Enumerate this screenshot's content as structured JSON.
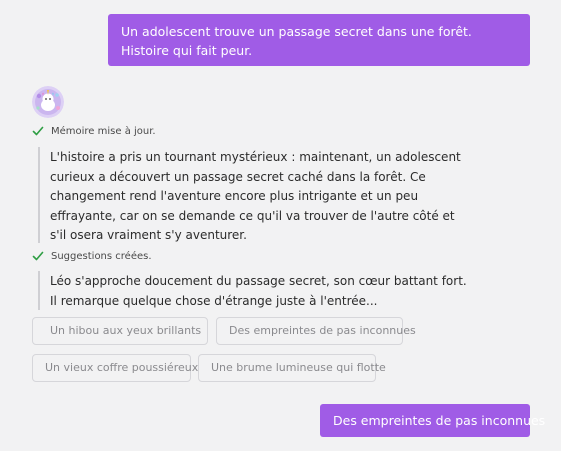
{
  "messages": {
    "user_prompt": "Un adolescent trouve un passage secret dans une forêt. Histoire qui fait peur.",
    "user_choice": "Des empreintes de pas inconnues"
  },
  "assistant": {
    "avatar_icon": "unicorn-avatar-icon",
    "memory_status": "Mémoire mise à jour.",
    "memory_text": "L'histoire a pris un tournant mystérieux : maintenant, un adolescent curieux a découvert un passage secret caché dans la forêt. Ce changement rend l'aventure encore plus intrigante et un peu effrayante, car on se demande ce qu'il va trouver de l'autre côté et s'il osera vraiment s'y aventurer.",
    "suggestions_status": "Suggestions créées.",
    "suggestions_text": "Léo s'approche doucement du passage secret, son cœur battant fort. Il remarque quelque chose d'étrange juste à l'entrée..."
  },
  "suggestions": [
    {
      "label": "Un hibou aux yeux brillants",
      "icon": "owl-icon"
    },
    {
      "label": "Des empreintes de pas inconnues"
    },
    {
      "label": "Un vieux coffre poussiéreux"
    },
    {
      "label": "Une brume lumineuse qui flotte"
    }
  ],
  "colors": {
    "accent": "#a05ce6",
    "check": "#2f9e44",
    "background": "#f2f2f3"
  }
}
